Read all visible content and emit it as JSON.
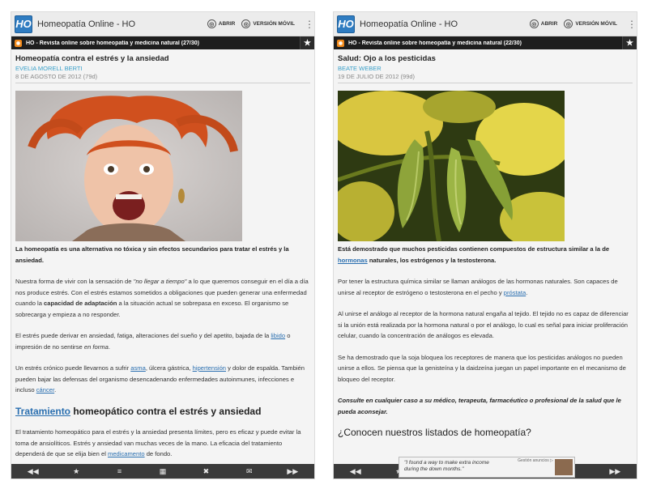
{
  "left": {
    "app": {
      "title": "Homeopatía Online - HO",
      "logo": "HO",
      "open_label": "ABRIR",
      "mobile_label": "VERSIÓN MÓVIL"
    },
    "feed": {
      "title": "HO - Revista online sobre homeopatía y medicina natural (27/30)"
    },
    "article": {
      "title": "Homeopatía contra el estrés y la ansiedad",
      "author": "EVELIA MORELL BERTI",
      "date": "8 DE AGOSTO DE 2012 (79d)",
      "intro": "La homeopatía es una alternativa no tóxica y sin efectos secundarios para tratar el estrés y la ansiedad.",
      "p1a": "Nuestra forma de vivir con la sensación de ",
      "p1b": "\"no llegar a tiempo\"",
      "p1c": " a lo que queremos conseguir en el día a día nos produce estrés. Con el estrés estamos sometidos a obligaciones que pueden generar una enfermedad cuando la ",
      "p1d": "capacidad de adaptación",
      "p1e": " a la situación actual se sobrepasa en exceso. El organismo se sobrecarga y empieza a no responder.",
      "p2a": "El estrés puede derivar en ansiedad, fatiga, alteraciones del sueño y del apetito, bajada de la ",
      "p2link": "libido",
      "p2b": " o impresión de no sentirse ",
      "p2c": "en forma",
      "p2d": ".",
      "p3a": "Un estrés crónico puede llevarnos a sufrir ",
      "p3link1": "asma",
      "p3b": ", úlcera gástrica, ",
      "p3link2": "hipertensión",
      "p3c": " y dolor de espalda. También pueden bajar las defensas del organismo desencadenando enfermedades autoinmunes, infecciones e incluso ",
      "p3link3": "cáncer",
      "p3d": ".",
      "h2link": "Tratamiento",
      "h2rest": " homeopático contra el estrés y ansiedad",
      "p4a": "El tratamiento homeopático para el estrés y la ansiedad presenta límites, pero es eficaz y puede evitar la toma de ansiolíticos. Estrés y ansiedad van muchas veces de la mano. La eficacia del tratamiento dependerá de que se elija bien el ",
      "p4link": "medicamento",
      "p4b": " de fondo."
    }
  },
  "right": {
    "app": {
      "title": "Homeopatía Online - HO",
      "logo": "HO",
      "open_label": "ABRIR",
      "mobile_label": "VERSIÓN MÓVIL"
    },
    "feed": {
      "title": "HO - Revista online sobre homeopatía y medicina natural (22/30)"
    },
    "article": {
      "title": "Salud: Ojo a los pesticidas",
      "author": "BEATE WEBER",
      "date": "19 DE JULIO DE 2012 (99d)",
      "intro_a": "Está demostrado que muchos pesticidas contienen compuestos de estructura similar a la de ",
      "intro_link": "hormonas",
      "intro_b": " naturales, los estrógenos y la testosterona.",
      "p1a": "Por tener la estructura química similar se llaman análogos de las hormonas naturales. Son capaces de unirse al receptor de estrógeno o testosterona en el pecho y ",
      "p1link": "próstata",
      "p1b": ".",
      "p2": "Al unirse el análogo al receptor de la hormona natural engaña al tejido. El tejido no es capaz de diferenciar si la unión está realizada por la hormona natural o por el análogo, lo cual es señal para iniciar proliferación celular, cuando la concentración de análogos es elevada.",
      "p3": "Se ha demostrado que la soja bloquea los receptores de manera que los pesticidas análogos no pueden unirse a ellos. Se piensa que la genisteína y la daidzeína juegan un papel importante en el mecanismo de bloqueo del receptor.",
      "p4": "Consulte en cualquier caso a su médico, terapeuta, farmacéutico  o profesional de la salud que le pueda aconsejar.",
      "h2": "¿Conocen nuestros listados de homeopatía?"
    },
    "ad": {
      "line1": "\"I found a way to make extra income",
      "line2": "during the down months.\"",
      "label": "Gestión anuncios ▷"
    }
  },
  "icons": {
    "prev": "◀◀",
    "star": "★",
    "list": "≡",
    "grid": "▦",
    "close": "✖",
    "mail": "✉",
    "next": "▶▶"
  }
}
